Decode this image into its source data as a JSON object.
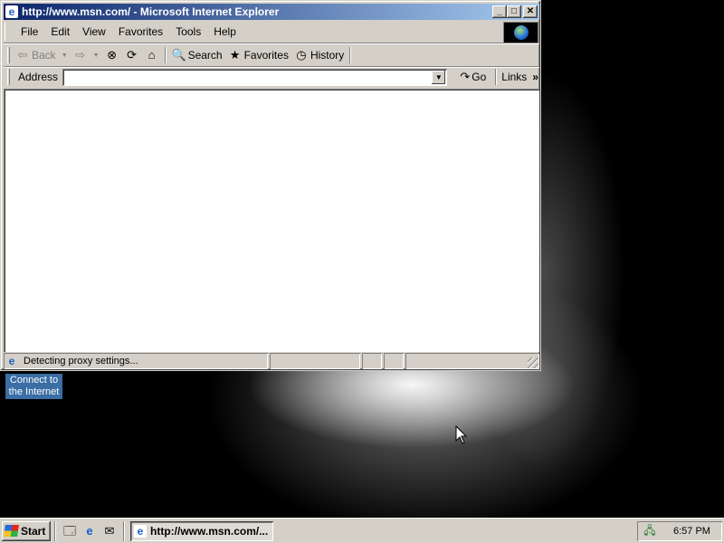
{
  "window": {
    "title": "http://www.msn.com/ - Microsoft Internet Explorer",
    "buttons": {
      "minimize": "_",
      "maximize": "□",
      "close": "✕"
    }
  },
  "menu": {
    "items": [
      "File",
      "Edit",
      "View",
      "Favorites",
      "Tools",
      "Help"
    ]
  },
  "toolbar": {
    "back_label": "Back",
    "search_label": "Search",
    "favorites_label": "Favorites",
    "history_label": "History"
  },
  "address": {
    "label": "Address",
    "value": "",
    "go_label": "Go",
    "links_label": "Links",
    "links_more": "»"
  },
  "status": {
    "text": "Detecting proxy settings..."
  },
  "desktop": {
    "icon_label_line1": "Connect to",
    "icon_label_line2": "the Internet"
  },
  "taskbar": {
    "start_label": "Start",
    "task_label": "http://www.msn.com/...",
    "clock": "6:57 PM"
  }
}
